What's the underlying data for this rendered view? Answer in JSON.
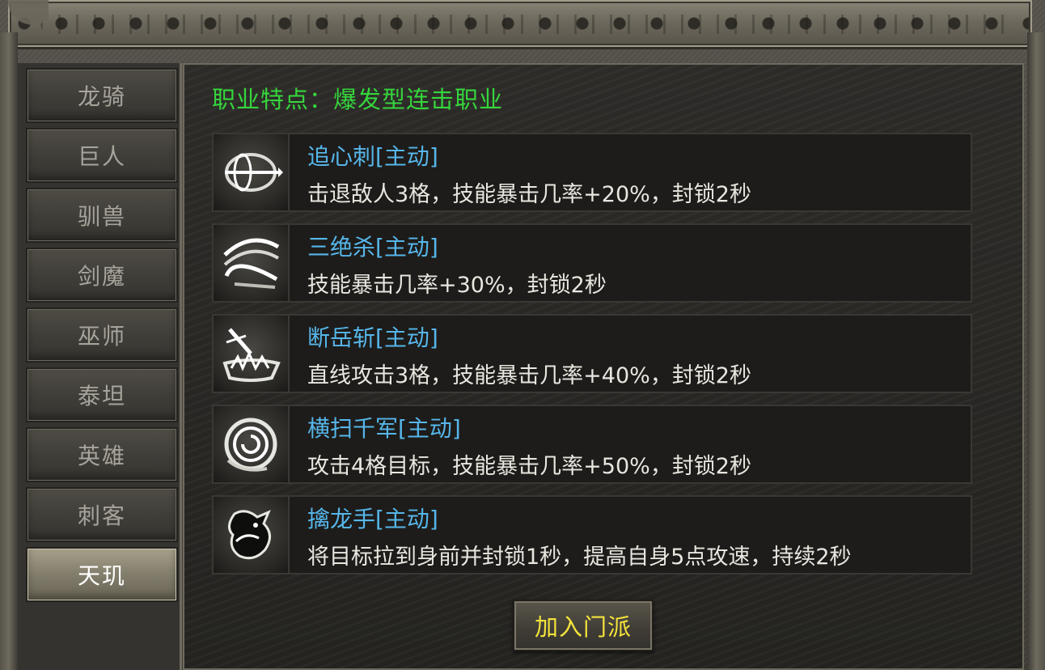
{
  "sidebar": {
    "tabs": [
      {
        "label": "龙骑"
      },
      {
        "label": "巨人"
      },
      {
        "label": "驯兽"
      },
      {
        "label": "剑魔"
      },
      {
        "label": "巫师"
      },
      {
        "label": "泰坦"
      },
      {
        "label": "英雄"
      },
      {
        "label": "刺客"
      },
      {
        "label": "天玑"
      }
    ],
    "active_index": 8
  },
  "main": {
    "feature": "职业特点：爆发型连击职业",
    "skills": [
      {
        "name": "追心刺[主动]",
        "desc": "击退敌人3格，技能暴击几率+20%，封锁2秒",
        "icon": "sword-slash-icon"
      },
      {
        "name": "三绝杀[主动]",
        "desc": "技能暴击几率+30%，封锁2秒",
        "icon": "triple-slash-icon"
      },
      {
        "name": "断岳斩[主动]",
        "desc": "直线攻击3格，技能暴击几率+40%，封锁2秒",
        "icon": "ground-smash-icon"
      },
      {
        "name": "横扫千军[主动]",
        "desc": "攻击4格目标，技能暴击几率+50%，封锁2秒",
        "icon": "whirlwind-icon"
      },
      {
        "name": "擒龙手[主动]",
        "desc": "将目标拉到身前并封锁1秒，提高自身5点攻速，持续2秒",
        "icon": "dragon-grab-icon"
      }
    ],
    "join_button": "加入门派"
  },
  "colors": {
    "feature_text": "#35d63c",
    "skill_name": "#56b6ea",
    "skill_desc": "#e8e6df",
    "join_button_text": "#f3e33c",
    "tab_text": "#a7a49b",
    "tab_active_text": "#ffffff"
  }
}
